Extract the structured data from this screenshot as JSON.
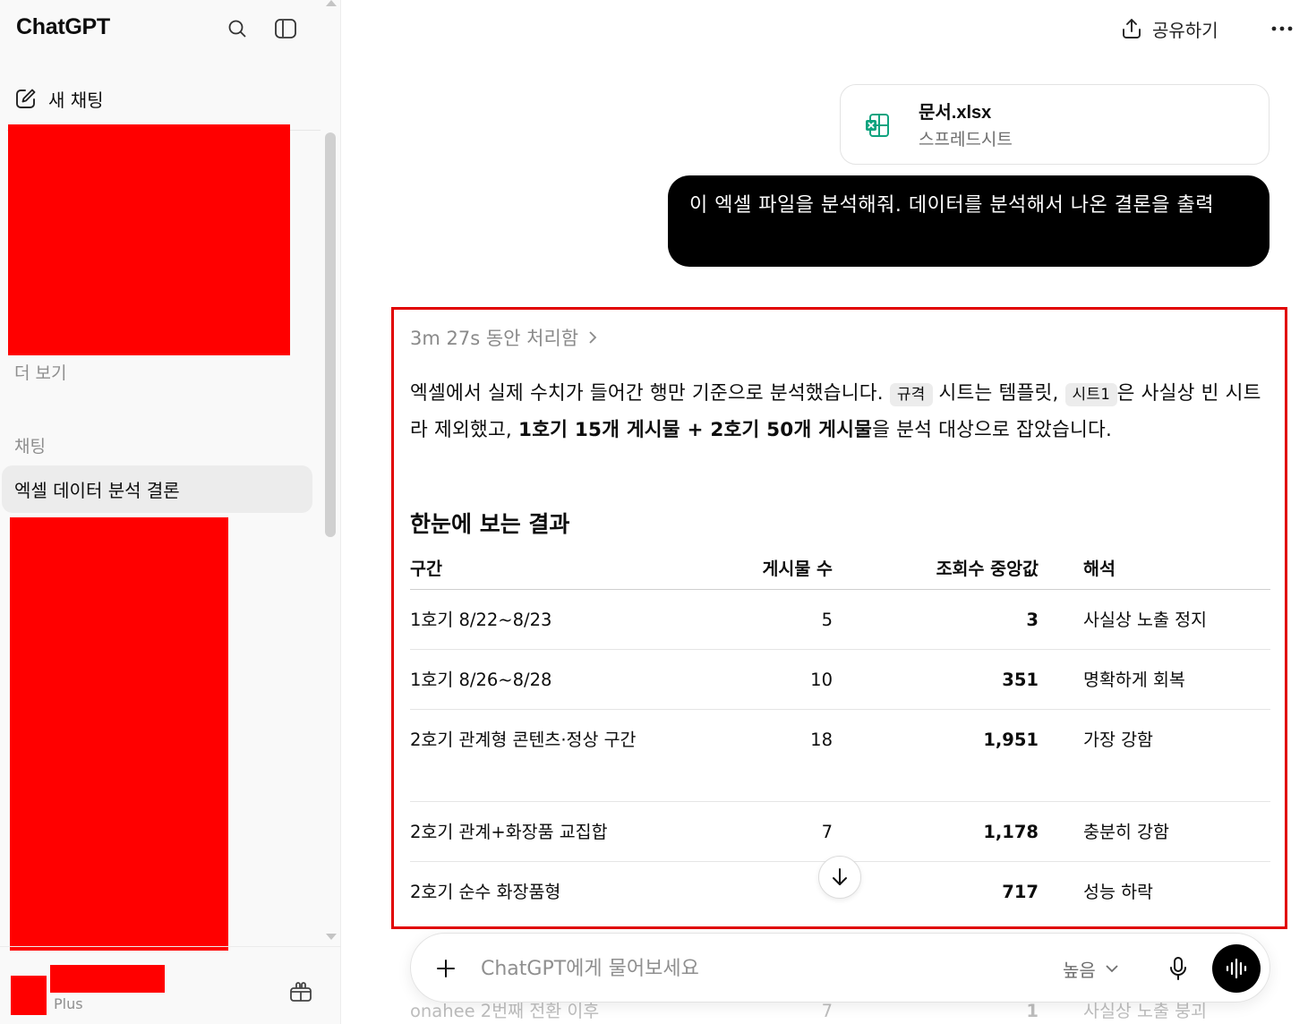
{
  "sidebar": {
    "brand": "ChatGPT",
    "new_chat_label": "새 채팅",
    "more_label": "더 보기",
    "section_label": "채팅",
    "active_chat": "엑셀 데이터 분석 결론",
    "plan_label": "Plus",
    "icons": [
      "search-icon",
      "sidebar-toggle-icon",
      "edit-icon",
      "gift-icon"
    ]
  },
  "header": {
    "share_label": "공유하기",
    "more_label": "···"
  },
  "attachment": {
    "file_name": "문서.xlsx",
    "file_type": "스프레드시트",
    "accent_color": "#10a37f"
  },
  "user_message": "이 엑셀 파일을 분석해줘. 데이터를 분석해서 나온 결론을 출력",
  "assistant": {
    "thought_label": "3m 27s 동안 처리함",
    "paragraph": {
      "p1": "엑셀에서 실제 수치가 들어간 행만 기준으로 분석했습니다.",
      "code1": "규격",
      "p2": "시트는 템플릿,",
      "code2": "시트1",
      "p3": "은 사실상 빈 시트라 제외했고,",
      "bold": "1호기 15개 게시물 + 2호기 50개 게시물",
      "p4": "을 분석 대상으로 잡았습니다."
    },
    "heading": "한눈에 보는 결과",
    "table": {
      "headers": [
        "구간",
        "게시물 수",
        "조회수 중앙값",
        "해석"
      ],
      "rows": [
        [
          "1호기 8/22~8/23",
          "5",
          "3",
          "사실상 노출 정지"
        ],
        [
          "1호기 8/26~8/28",
          "10",
          "351",
          "명확하게 회복"
        ],
        [
          "2호기 관계형 콘텐츠·정상 구간",
          "18",
          "1,951",
          "가장 강함"
        ],
        [
          "2호기 관계+화장품 교집합",
          "7",
          "1,178",
          "충분히 강함"
        ],
        [
          "2호기 순수 화장품형",
          "",
          "717",
          "성능 하락"
        ]
      ],
      "ghost_row": [
        "onahee 2번째 전환 이후",
        "7",
        "1",
        "사실상 노출 붕괴"
      ]
    }
  },
  "composer": {
    "placeholder": "ChatGPT에게 물어보세요",
    "model_label": "높음"
  },
  "colors": {
    "highlight": "#e10000",
    "redaction": "#ff0000",
    "user_bubble": "#000000"
  }
}
